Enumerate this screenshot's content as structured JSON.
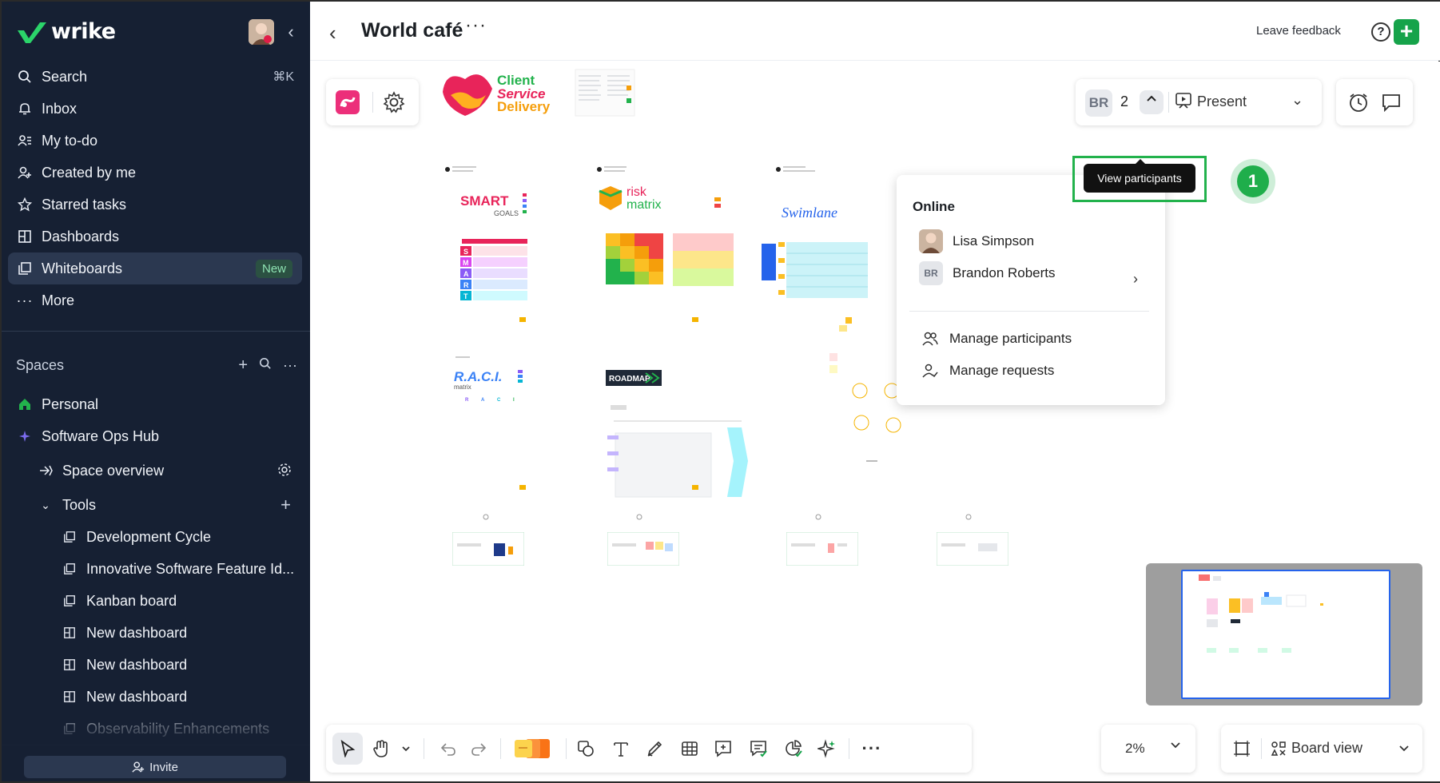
{
  "app": {
    "brand": "wrike"
  },
  "sidebar": {
    "search": {
      "label": "Search",
      "shortcut": "⌘K"
    },
    "items": [
      {
        "label": "Inbox",
        "icon": "bell-icon"
      },
      {
        "label": "My to-do",
        "icon": "todo-icon"
      },
      {
        "label": "Created by me",
        "icon": "user-plus-icon"
      },
      {
        "label": "Starred tasks",
        "icon": "star-icon"
      },
      {
        "label": "Dashboards",
        "icon": "dashboard-icon"
      },
      {
        "label": "Whiteboards",
        "icon": "whiteboard-icon",
        "badge": "New",
        "active": true
      },
      {
        "label": "More",
        "icon": "more-icon"
      }
    ],
    "spaces_title": "Spaces",
    "tree": [
      {
        "label": "Personal",
        "icon": "home-icon"
      },
      {
        "label": "Software Ops Hub",
        "icon": "sparkle-icon"
      },
      {
        "label": "Space overview",
        "icon": "overview-icon"
      },
      {
        "label": "Tools",
        "icon": "chevron-down-icon"
      },
      {
        "label": "Development Cycle",
        "icon": "whiteboard-icon"
      },
      {
        "label": "Innovative Software Feature Id...",
        "icon": "whiteboard-icon"
      },
      {
        "label": "Kanban board",
        "icon": "whiteboard-icon"
      },
      {
        "label": "New dashboard",
        "icon": "dashboard-icon"
      },
      {
        "label": "New dashboard",
        "icon": "dashboard-icon"
      },
      {
        "label": "New dashboard",
        "icon": "dashboard-icon"
      },
      {
        "label": "Observability Enhancements",
        "icon": "whiteboard-icon"
      }
    ],
    "invite": "Invite"
  },
  "header": {
    "title": "World café",
    "more": "···",
    "feedback": "Leave feedback"
  },
  "toolbar": {
    "participant_initials": "BR",
    "participant_count": "2",
    "present": "Present",
    "tooltip": "View participants",
    "step": "1"
  },
  "participants": {
    "heading": "Online",
    "people": [
      {
        "name": "Lisa Simpson"
      },
      {
        "name": "Brandon Roberts",
        "initials": "BR"
      }
    ],
    "actions": [
      "Manage participants",
      "Manage requests"
    ]
  },
  "board": {
    "logo_line1": "Client",
    "logo_line2": "Service",
    "logo_line3": "Delivery",
    "smart": "SMART",
    "goals": "GOALS",
    "risk": "risk",
    "matrix": "matrix",
    "swimlane": "Swimlane",
    "raci": "R.A.C.I.",
    "raci_sub": "matrix",
    "roadmap": "ROADMAP",
    "smart_letters": [
      "S",
      "M",
      "A",
      "R",
      "T"
    ],
    "raci_letters": [
      "R",
      "A",
      "C",
      "I"
    ]
  },
  "bottom": {
    "zoom": "2%",
    "view": "Board view"
  },
  "colors": {
    "sidebar_bg": "#162033",
    "accent_green": "#16a34a",
    "highlight": "#22b24c"
  }
}
